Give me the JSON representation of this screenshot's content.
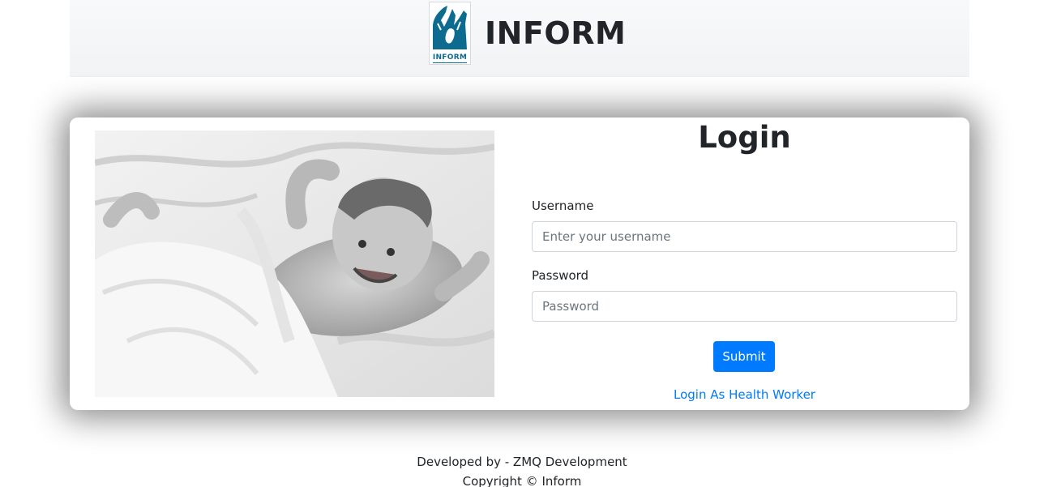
{
  "header": {
    "logo_text": "INFORM",
    "title": "INFORM"
  },
  "login": {
    "title": "Login",
    "username_label": "Username",
    "username_placeholder": "Enter your username",
    "password_label": "Password",
    "password_placeholder": "Password",
    "submit_label": "Submit",
    "health_worker_link": "Login As Health Worker"
  },
  "footer": {
    "developed_by": "Developed by - ZMQ Development",
    "copyright": "Copyright © Inform"
  },
  "colors": {
    "primary": "#007bff",
    "logo_blue": "#0c6b8e",
    "header_bg": "#f8f9fa"
  }
}
